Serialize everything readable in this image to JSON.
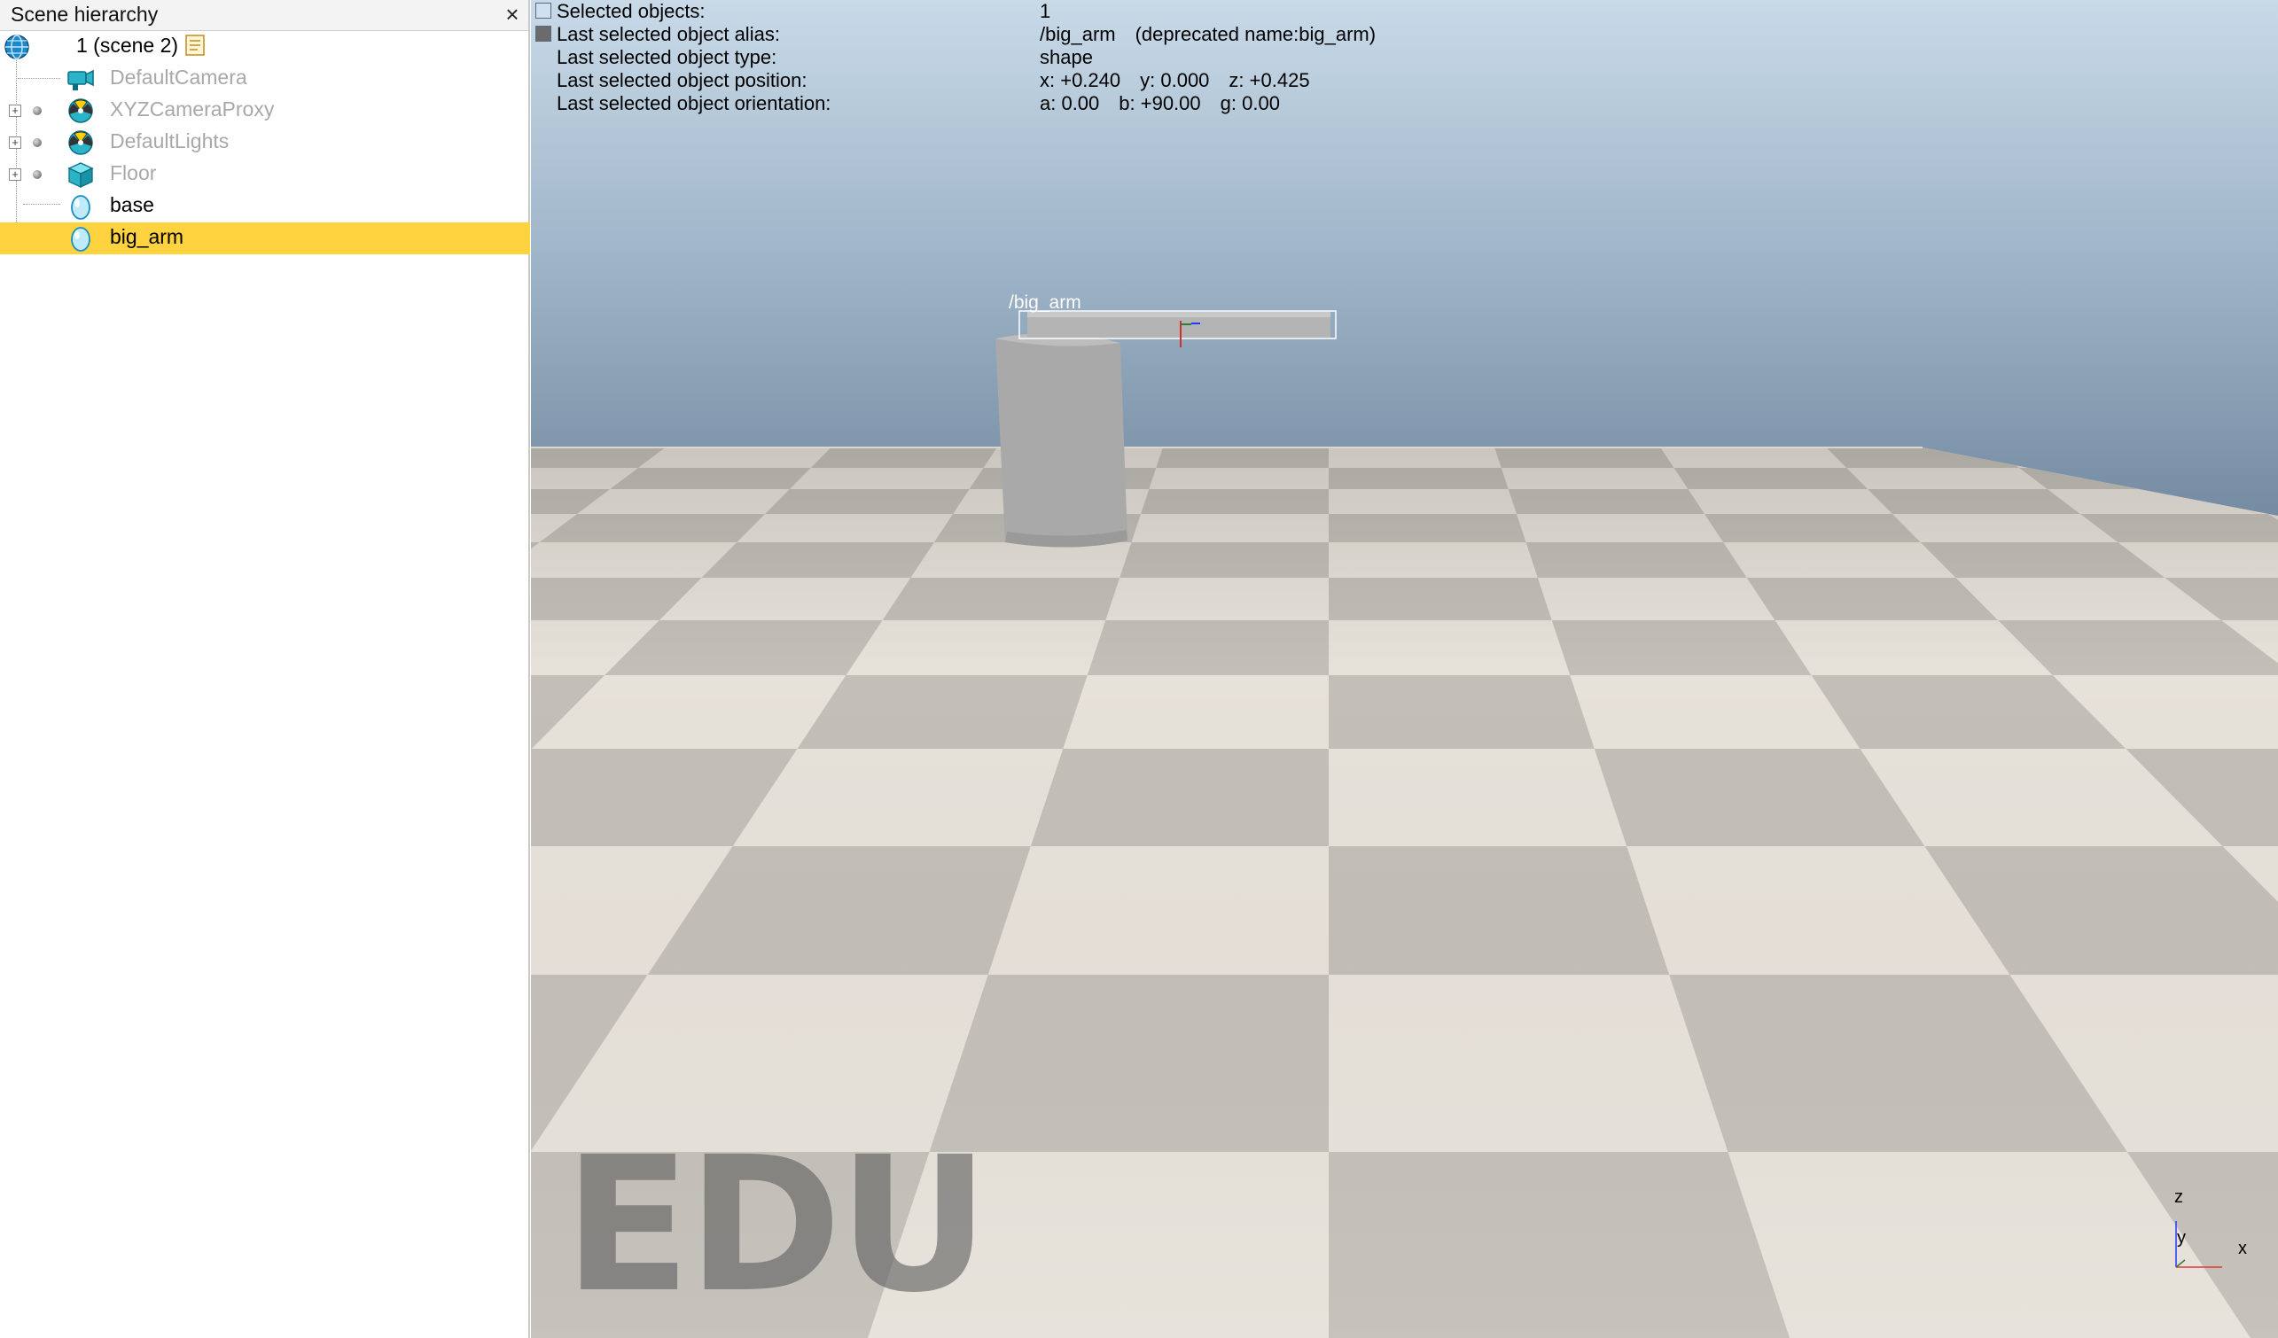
{
  "hierarchy": {
    "title": "Scene hierarchy",
    "close_glyph": "×",
    "items": [
      {
        "label": "1 (scene 2)",
        "icon": "globe-icon"
      },
      {
        "label": "DefaultCamera",
        "icon": "camera-icon"
      },
      {
        "label": "XYZCameraProxy",
        "icon": "dummy-icon",
        "expander": "+"
      },
      {
        "label": "DefaultLights",
        "icon": "dummy-icon",
        "expander": "+"
      },
      {
        "label": "Floor",
        "icon": "cube-icon",
        "expander": "+"
      },
      {
        "label": "base",
        "icon": "shape-icon"
      },
      {
        "label": "big_arm",
        "icon": "shape-icon",
        "selected": true
      }
    ]
  },
  "viewport": {
    "info": {
      "rows": [
        {
          "label": "Selected objects:",
          "value": "1"
        },
        {
          "label": "Last selected object alias:",
          "value": "/big_arm",
          "extra": "(deprecated name:big_arm)"
        },
        {
          "label": "Last selected object type:",
          "value": "shape"
        },
        {
          "label": "Last selected object position:",
          "value": "x: +0.240",
          "value2": "y: 0.000",
          "value3": "z: +0.425"
        },
        {
          "label": "Last selected object orientation:",
          "value": "a: 0.00",
          "value2": "b: +90.00",
          "value3": "g: 0.00"
        }
      ]
    },
    "object_label": "/big_arm",
    "watermark": "EDU",
    "axes": {
      "z": "z",
      "y": "y",
      "x": "x"
    },
    "colors": {
      "selection": "#ffd23f",
      "axis_x": "#e53935",
      "axis_y": "#2e7d32",
      "axis_z": "#1e3aff"
    }
  }
}
